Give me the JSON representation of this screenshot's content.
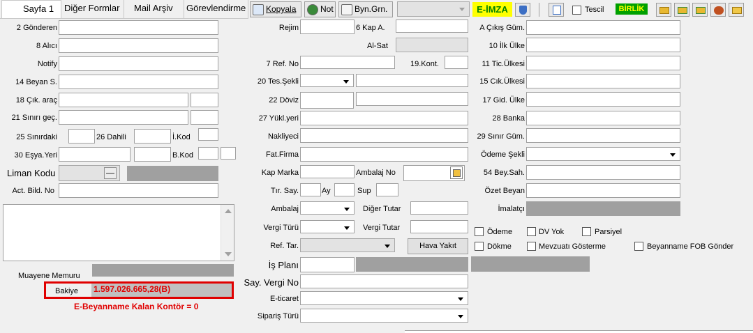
{
  "tabs": [
    "Sayfa 1",
    "Diğer Formlar",
    "Mail Arşiv",
    "Görevlendirme"
  ],
  "toolbar": {
    "kopyala": "Kopyala",
    "not": "Not",
    "byn": "Byn.Grn.",
    "eimza": "E-İMZA",
    "tescil": "Tescil",
    "birlik": "BİRLİK"
  },
  "left": {
    "gonderen": "2 Gönderen",
    "alici": "8 Alıcı",
    "notify": "Notify",
    "beyan_s": "14 Beyan S.",
    "cik_arac": "18 Çık. araç",
    "siniri_gec": "21 Sınırı geç.",
    "sinirdaki": "25 Sınırdaki",
    "dahili": "26 Dahili",
    "ikod": "İ.Kod",
    "esya_yeri": "30 Eşya.Yeri",
    "bkod": "B.Kod",
    "liman_kodu": "Liman Kodu",
    "act_bild_no": "Act. Bild. No",
    "muayene_memuru": "Muayene Memuru",
    "bakiye_label": "Bakiye",
    "bakiye_value": "1.597.026.665,28(B)",
    "kontor": "E-Beyanname Kalan Kontör = 0"
  },
  "middle": {
    "rejim": "Rejim",
    "kap_a": "6 Kap A.",
    "al_sat": "Al-Sat",
    "ref_no": "7 Ref. No",
    "kont": "19.Kont.",
    "tes_sekli": "20 Tes.Şekli",
    "doviz": "22 Döviz",
    "yukl_yeri": "27 Yükl.yeri",
    "nakliyeci": "Nakliyeci",
    "fat_firma": "Fat.Firma",
    "kap_marka": "Kap Marka",
    "ambalaj_no": "Ambalaj No",
    "tir_say": "Tır. Say.",
    "ay": "Ay",
    "sup": "Sup",
    "ambalaj": "Ambalaj",
    "diger_tutar": "Diğer Tutar",
    "vergi_turu": "Vergi Türü",
    "vergi_tutar": "Vergi Tutar",
    "ref_tar": "Ref. Tar.",
    "hava_yakit": "Hava Yakıt",
    "is_plani": "İş Planı",
    "say_vergi_no": "Say. Vergi No",
    "e_ticaret": "E-ticaret",
    "siparis_turu": "Sipariş Türü"
  },
  "right": {
    "a_cikis_gum": "A Çıkış Güm.",
    "ilk_ulke": "10 İlk Ülke",
    "tic_ulkesi": "11 Tic.Ülkesi",
    "cik_ulkesi": "15 Cık.Ülkesi",
    "gid_ulke": "17 Gid. Ülke",
    "banka": "28 Banka",
    "sinir_gum": "29 Sınır Güm.",
    "odeme_sekli": "Ödeme Şekli",
    "bey_sah": "54 Bey.Sah.",
    "ozet_beyan": "Özet Beyan",
    "imalatci": "İmalatçı"
  },
  "checkboxes": {
    "odeme": "Ödeme",
    "dv_yok": "DV Yok",
    "parsiyel": "Parsiyel",
    "dokme": "Dökme",
    "mevzuati": "Mevzuatı Gösterme",
    "fob": "Beyanname FOB Gönder"
  },
  "colors": {
    "eimza_bg": "#ffff00",
    "eimza_fg": "#008000",
    "birlik_bg": "#00a000",
    "birlik_fg": "#ffff00",
    "alert_red": "#e00000",
    "bakiye_box": "#c0c0c0"
  }
}
